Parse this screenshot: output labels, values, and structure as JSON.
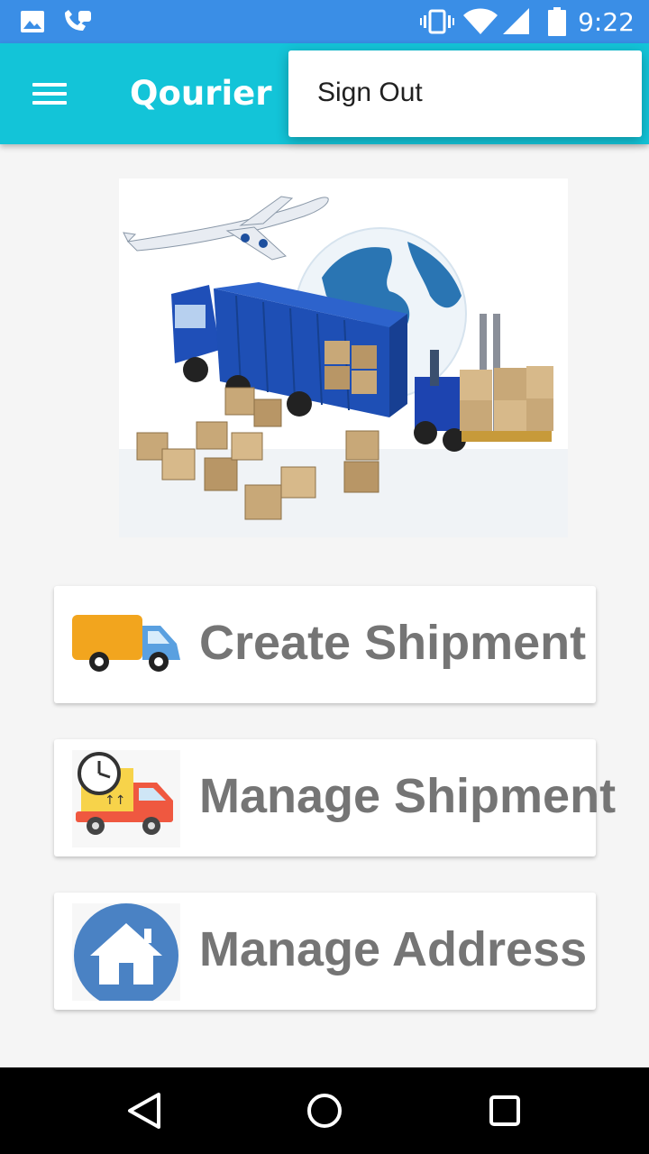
{
  "status_bar": {
    "time": "9:22",
    "icons": [
      "image-icon",
      "phone-alert-icon",
      "vibrate-icon",
      "wifi-icon",
      "signal-icon",
      "battery-icon"
    ]
  },
  "app_bar": {
    "title": "Qourier",
    "menu_icon": "hamburger-menu-icon"
  },
  "overflow_menu": {
    "items": [
      {
        "label": "Sign Out"
      }
    ]
  },
  "hero": {
    "icon": "logistics-illustration"
  },
  "actions": [
    {
      "label": "Create Shipment",
      "icon": "delivery-truck-icon"
    },
    {
      "label": "Manage Shipment",
      "icon": "timed-delivery-truck-icon"
    },
    {
      "label": "Manage Address",
      "icon": "home-icon"
    }
  ],
  "nav_bar": {
    "icons": [
      "back-icon",
      "home-circle-icon",
      "recents-icon"
    ]
  },
  "colors": {
    "status_bar": "#3a8ee6",
    "app_bar": "#13c4d8",
    "card_text": "#757575",
    "background": "#f5f5f5"
  }
}
